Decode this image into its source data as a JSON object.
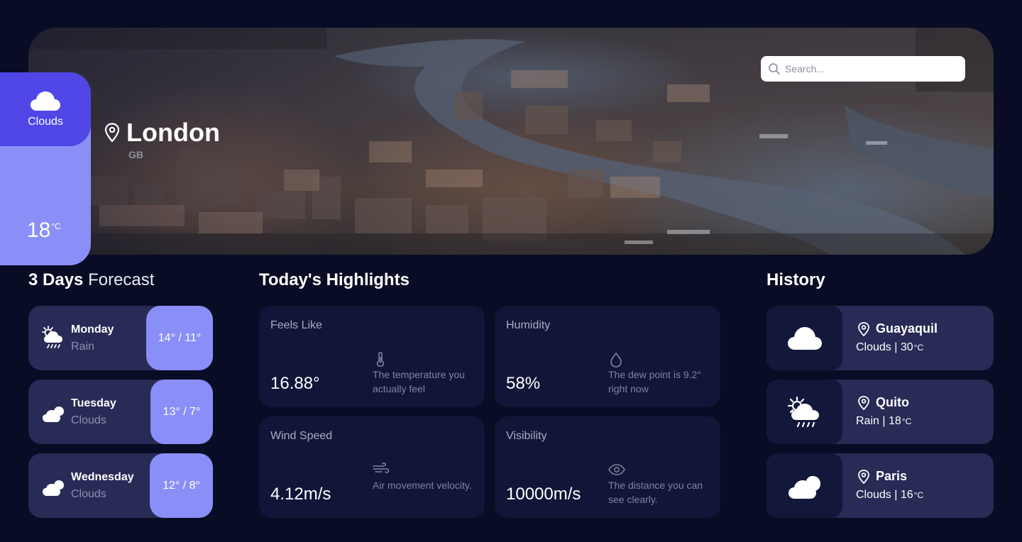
{
  "hero": {
    "search_placeholder": "Search...",
    "condition": "Clouds",
    "temperature": "18",
    "temperature_unit": "°C",
    "city": "London",
    "country": "GB"
  },
  "forecast": {
    "title_bold": "3 Days",
    "title_light": "Forecast",
    "days": [
      {
        "day": "Monday",
        "condition": "Rain",
        "temps": "14° / 11°",
        "icon": "sun-rain-icon"
      },
      {
        "day": "Tuesday",
        "condition": "Clouds",
        "temps": "13° / 7°",
        "icon": "clouds-icon"
      },
      {
        "day": "Wednesday",
        "condition": "Clouds",
        "temps": "12° / 8°",
        "icon": "clouds-icon"
      }
    ]
  },
  "highlights": {
    "title": "Today's Highlights",
    "cards": [
      {
        "label": "Feels Like",
        "value": "16.88°",
        "desc": "The temperature you actually feel",
        "icon": "thermometer-icon"
      },
      {
        "label": "Humidity",
        "value": "58%",
        "desc": "The dew point is 9.2° right now",
        "icon": "droplet-icon"
      },
      {
        "label": "Wind Speed",
        "value": "4.12m/s",
        "desc": "Air movement velocity.",
        "icon": "wind-icon"
      },
      {
        "label": "Visibility",
        "value": "10000m/s",
        "desc": "The distance you can see clearly.",
        "icon": "eye-icon"
      }
    ]
  },
  "history": {
    "title": "History",
    "items": [
      {
        "city": "Guayaquil",
        "condition": "Clouds",
        "separator": "|",
        "temp": "30",
        "unit": "°C",
        "icon": "cloud-icon"
      },
      {
        "city": "Quito",
        "condition": "Rain",
        "separator": "|",
        "temp": "18",
        "unit": "°C",
        "icon": "sun-rain-icon"
      },
      {
        "city": "Paris",
        "condition": "Clouds",
        "separator": "|",
        "temp": "16",
        "unit": "°C",
        "icon": "clouds-icon"
      }
    ]
  },
  "colors": {
    "background": "#080c24",
    "accent_dark": "#5046e6",
    "accent_light": "#8a8ff7",
    "card": "#272b55",
    "card_dark": "#111638"
  }
}
